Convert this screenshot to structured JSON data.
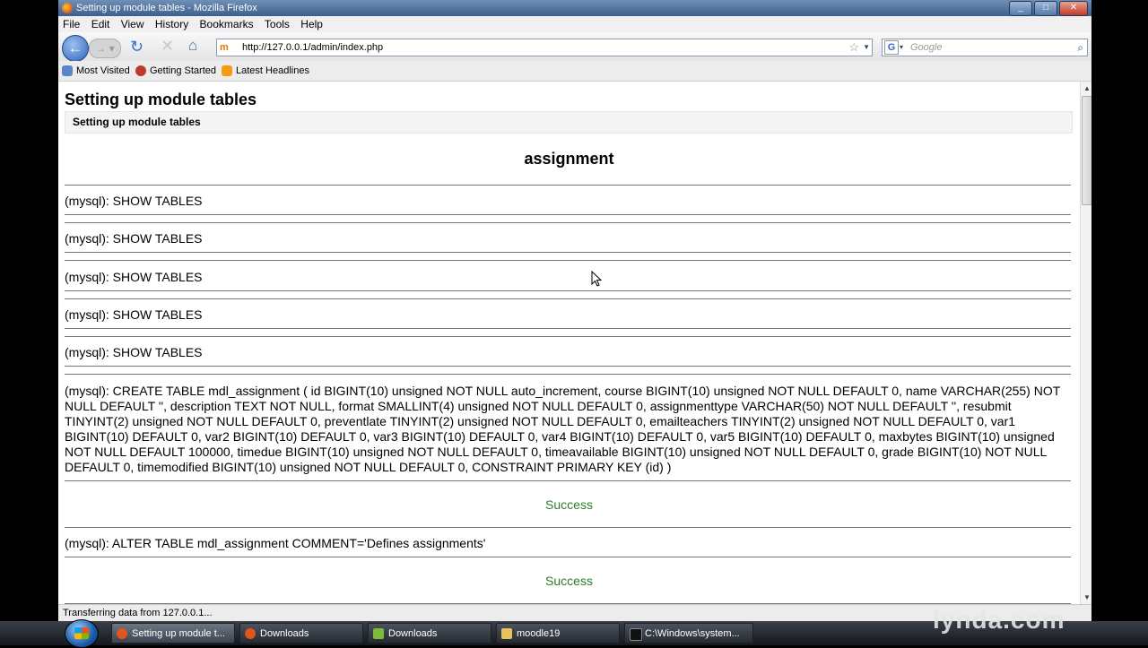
{
  "window": {
    "title": "Setting up module tables - Mozilla Firefox",
    "controls": [
      "_",
      "□",
      "✕"
    ]
  },
  "menu": [
    "File",
    "Edit",
    "View",
    "History",
    "Bookmarks",
    "Tools",
    "Help"
  ],
  "nav": {
    "url": "http://127.0.0.1/admin/index.php",
    "search_placeholder": "Google"
  },
  "bookmarks": [
    "Most Visited",
    "Getting Started",
    "Latest Headlines"
  ],
  "page": {
    "heading": "Setting up module tables",
    "subheading": "Setting up module tables",
    "module": "assignment",
    "queries": [
      "(mysql): SHOW TABLES",
      "(mysql): SHOW TABLES",
      "(mysql): SHOW TABLES",
      "(mysql): SHOW TABLES",
      "(mysql): SHOW TABLES"
    ],
    "create_sql": "(mysql): CREATE TABLE mdl_assignment ( id BIGINT(10) unsigned NOT NULL auto_increment, course BIGINT(10) unsigned NOT NULL DEFAULT 0, name VARCHAR(255) NOT NULL DEFAULT '', description TEXT NOT NULL, format SMALLINT(4) unsigned NOT NULL DEFAULT 0, assignmenttype VARCHAR(50) NOT NULL DEFAULT '', resubmit TINYINT(2) unsigned NOT NULL DEFAULT 0, preventlate TINYINT(2) unsigned NOT NULL DEFAULT 0, emailteachers TINYINT(2) unsigned NOT NULL DEFAULT 0, var1 BIGINT(10) DEFAULT 0, var2 BIGINT(10) DEFAULT 0, var3 BIGINT(10) DEFAULT 0, var4 BIGINT(10) DEFAULT 0, var5 BIGINT(10) DEFAULT 0, maxbytes BIGINT(10) unsigned NOT NULL DEFAULT 100000, timedue BIGINT(10) unsigned NOT NULL DEFAULT 0, timeavailable BIGINT(10) unsigned NOT NULL DEFAULT 0, grade BIGINT(10) NOT NULL DEFAULT 0, timemodified BIGINT(10) unsigned NOT NULL DEFAULT 0, CONSTRAINT PRIMARY KEY (id) )",
    "success_1": "Success",
    "alter_sql": "(mysql): ALTER TABLE mdl_assignment COMMENT='Defines assignments'",
    "success_2": "Success"
  },
  "status": "Transferring data from 127.0.0.1...",
  "taskbar": [
    "Setting up module t...",
    "Downloads",
    "Downloads",
    "moodle19",
    "C:\\Windows\\system..."
  ],
  "watermark": "lynda.com"
}
